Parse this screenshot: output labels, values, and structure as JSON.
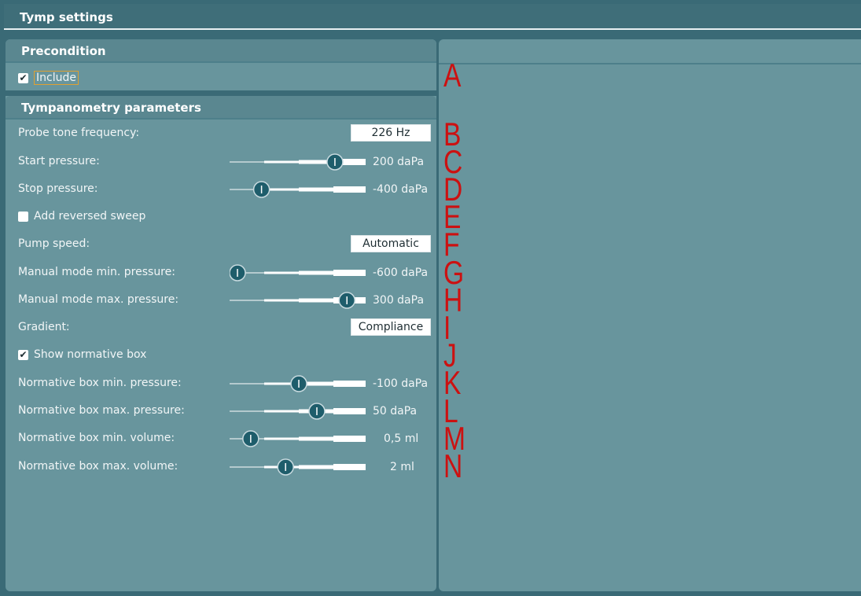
{
  "window": {
    "title": "Tymp settings"
  },
  "precondition": {
    "header": "Precondition",
    "include": {
      "label": "Include",
      "checked": true
    }
  },
  "tymp": {
    "header": "Tympanometry parameters",
    "probe_tone": {
      "label": "Probe tone frequency:",
      "value": "226 Hz"
    },
    "start_pressure": {
      "label": "Start pressure:",
      "value": "200 daPa",
      "position": 0.81
    },
    "stop_pressure": {
      "label": "Stop pressure:",
      "value": "-400 daPa",
      "position": 0.2
    },
    "reversed_sweep": {
      "label": "Add reversed sweep",
      "checked": false
    },
    "pump_speed": {
      "label": "Pump speed:",
      "value": "Automatic"
    },
    "manual_min": {
      "label": "Manual mode min. pressure:",
      "value": "-600 daPa",
      "position": 0.0
    },
    "manual_max": {
      "label": "Manual mode max. pressure:",
      "value": "300 daPa",
      "position": 0.91
    },
    "gradient": {
      "label": "Gradient:",
      "value": "Compliance"
    },
    "normative_box": {
      "label": "Show normative box",
      "checked": true
    },
    "norm_min_pressure": {
      "label": "Normative box min. pressure:",
      "value": "-100 daPa",
      "position": 0.51
    },
    "norm_max_pressure": {
      "label": "Normative box max. pressure:",
      "value": "50 daPa",
      "position": 0.66
    },
    "norm_min_volume": {
      "label": "Normative box min. volume:",
      "value": "0,5 ml",
      "position": 0.11
    },
    "norm_max_volume": {
      "label": "Normative box max. volume:",
      "value": "2 ml",
      "position": 0.4
    }
  },
  "markers": [
    "A",
    "B",
    "C",
    "D",
    "E",
    "F",
    "G",
    "H",
    "I",
    "J",
    "K",
    "L",
    "M",
    "N"
  ],
  "colors": {
    "background": "#3a6a76",
    "panel": "#68959d",
    "marker": "#cc1111",
    "knob": "#1e5d6b"
  }
}
